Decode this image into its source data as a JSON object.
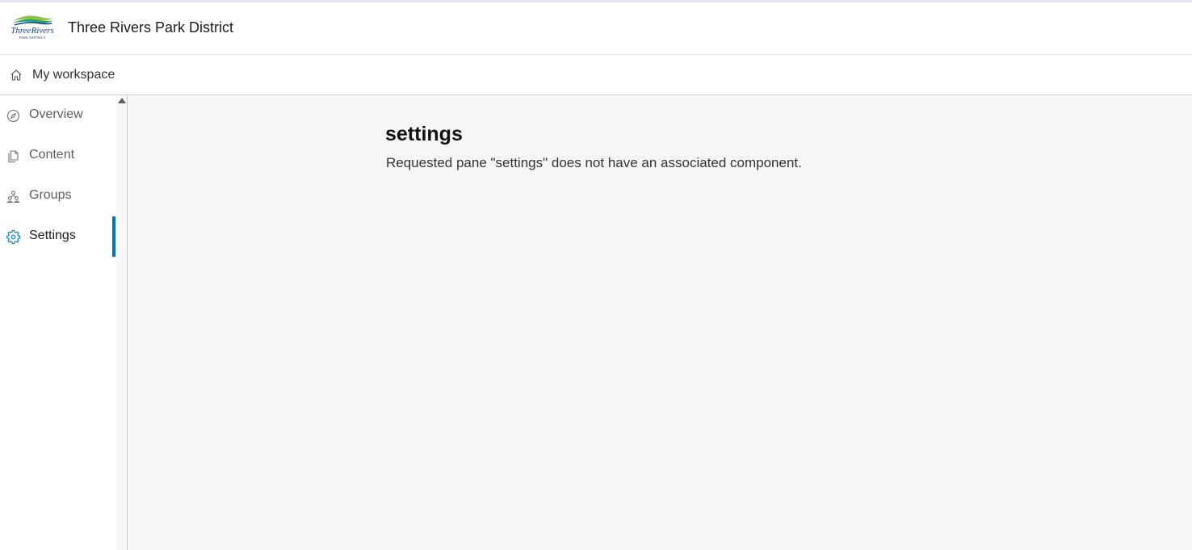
{
  "header": {
    "logo_text": "ThreeRivers",
    "logo_subtext": "PARK DISTRICT",
    "title": "Three Rivers Park District"
  },
  "breadcrumb": {
    "icon": "home-icon",
    "label": "My workspace"
  },
  "sidebar": {
    "items": [
      {
        "label": "Overview",
        "icon": "compass-icon",
        "active": false
      },
      {
        "label": "Content",
        "icon": "documents-icon",
        "active": false
      },
      {
        "label": "Groups",
        "icon": "groups-icon",
        "active": false
      },
      {
        "label": "Settings",
        "icon": "gear-icon",
        "active": true
      }
    ]
  },
  "pane": {
    "title": "settings",
    "message": "Requested pane \"settings\" does not have an associated component."
  },
  "colors": {
    "accent": "#0078b4",
    "main_background": "#f6f6f6",
    "logo_navy": "#1f3f7a",
    "logo_green": "#8cc63f",
    "logo_teal": "#2a9d8f"
  }
}
